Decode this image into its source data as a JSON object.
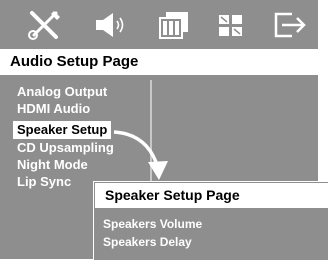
{
  "toolbar": {
    "icons": [
      "settings-tools-icon",
      "speaker-audio-icon",
      "film-video-icon",
      "preference-grid-icon",
      "exit-icon"
    ]
  },
  "audio_setup": {
    "title": "Audio Setup Page",
    "items": [
      "Analog Output",
      "HDMI Audio",
      "Speaker Setup",
      "CD Upsampling",
      "Night Mode",
      "Lip Sync"
    ],
    "selected": "Speaker Setup"
  },
  "speaker_setup": {
    "title": "Speaker Setup Page",
    "items": [
      "Speakers Volume",
      "Speakers Delay"
    ]
  },
  "colors": {
    "panel_bg": "#8e8e8e",
    "highlight": "#ffffff",
    "text": "#ffffff"
  }
}
